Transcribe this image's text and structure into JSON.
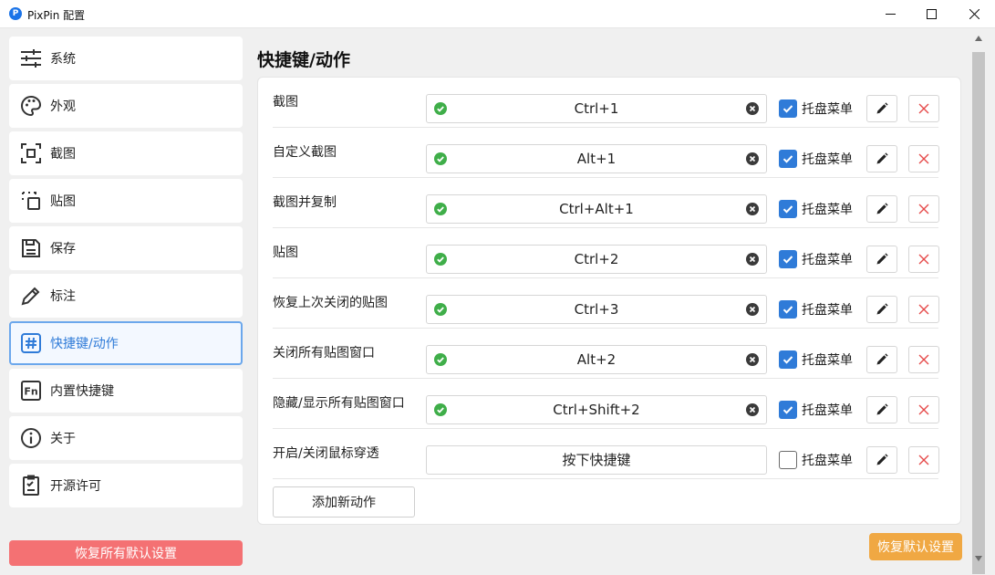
{
  "window": {
    "title": "PixPin 配置",
    "app_icon_letter": "P"
  },
  "sidebar": {
    "items": [
      {
        "label": "系统",
        "icon": "sliders-icon"
      },
      {
        "label": "外观",
        "icon": "palette-icon"
      },
      {
        "label": "截图",
        "icon": "screenshot-icon"
      },
      {
        "label": "贴图",
        "icon": "pin-icon"
      },
      {
        "label": "保存",
        "icon": "save-icon"
      },
      {
        "label": "标注",
        "icon": "pencil-icon"
      },
      {
        "label": "快捷键/动作",
        "icon": "hashtag-icon",
        "active": true
      },
      {
        "label": "内置快捷键",
        "icon": "fn-key-icon"
      },
      {
        "label": "关于",
        "icon": "info-icon"
      },
      {
        "label": "开源许可",
        "icon": "license-icon"
      }
    ],
    "reset_all_label": "恢复所有默认设置"
  },
  "main": {
    "title": "快捷键/动作",
    "rows": [
      {
        "label": "截图",
        "hotkey": "Ctrl+1",
        "tray_label": "托盘菜单",
        "tray_checked": true,
        "valid": true
      },
      {
        "label": "自定义截图",
        "hotkey": "Alt+1",
        "tray_label": "托盘菜单",
        "tray_checked": true,
        "valid": true
      },
      {
        "label": "截图并复制",
        "hotkey": "Ctrl+Alt+1",
        "tray_label": "托盘菜单",
        "tray_checked": true,
        "valid": true
      },
      {
        "label": "贴图",
        "hotkey": "Ctrl+2",
        "tray_label": "托盘菜单",
        "tray_checked": true,
        "valid": true
      },
      {
        "label": "恢复上次关闭的贴图",
        "hotkey": "Ctrl+3",
        "tray_label": "托盘菜单",
        "tray_checked": true,
        "valid": true
      },
      {
        "label": "关闭所有贴图窗口",
        "hotkey": "Alt+2",
        "tray_label": "托盘菜单",
        "tray_checked": true,
        "valid": true
      },
      {
        "label": "隐藏/显示所有贴图窗口",
        "hotkey": "Ctrl+Shift+2",
        "tray_label": "托盘菜单",
        "tray_checked": true,
        "valid": true
      },
      {
        "label": "开启/关闭鼠标穿透",
        "hotkey": "按下快捷键",
        "tray_label": "托盘菜单",
        "tray_checked": false,
        "valid": false
      }
    ],
    "add_action_label": "添加新动作",
    "reset_default_label": "恢复默认设置"
  },
  "colors": {
    "accent": "#2f7bd8",
    "valid_green": "#3fae49",
    "delete_red": "#e64b4b",
    "reset_all_bg": "#f47173",
    "reset_default_bg": "#f0a843"
  }
}
